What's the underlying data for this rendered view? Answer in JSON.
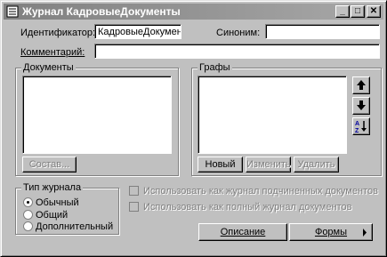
{
  "window": {
    "title": "Журнал КадровыеДокументы",
    "minimize": "_",
    "maximize": "□",
    "close": "✕"
  },
  "form": {
    "identifier_label": "Идентификатор:",
    "identifier_value": "КадровыеДокументы",
    "synonym_label": "Синоним:",
    "synonym_value": "",
    "comment_label": "Комментарий:",
    "comment_value": ""
  },
  "documents": {
    "group_label": "Документы",
    "button_compose": "Состав..."
  },
  "columns": {
    "group_label": "Графы",
    "button_new": "Новый",
    "button_edit": "Изменить",
    "button_delete": "Удалить",
    "move_up_icon": "arrow-up",
    "move_down_icon": "arrow-down",
    "sort_icon": "sort-az"
  },
  "journal_type": {
    "group_label": "Тип журнала",
    "options": [
      {
        "label": "Обычный",
        "checked": true
      },
      {
        "label": "Общий",
        "checked": false
      },
      {
        "label": "Дополнительный",
        "checked": false
      }
    ]
  },
  "checkboxes": [
    {
      "label": "Использовать как журнал подчиненных документов",
      "checked": false,
      "enabled": false
    },
    {
      "label": "Использовать как полный журнал документов",
      "checked": false,
      "enabled": false
    }
  ],
  "footer": {
    "button_description": "Описание",
    "button_forms": "Формы"
  }
}
